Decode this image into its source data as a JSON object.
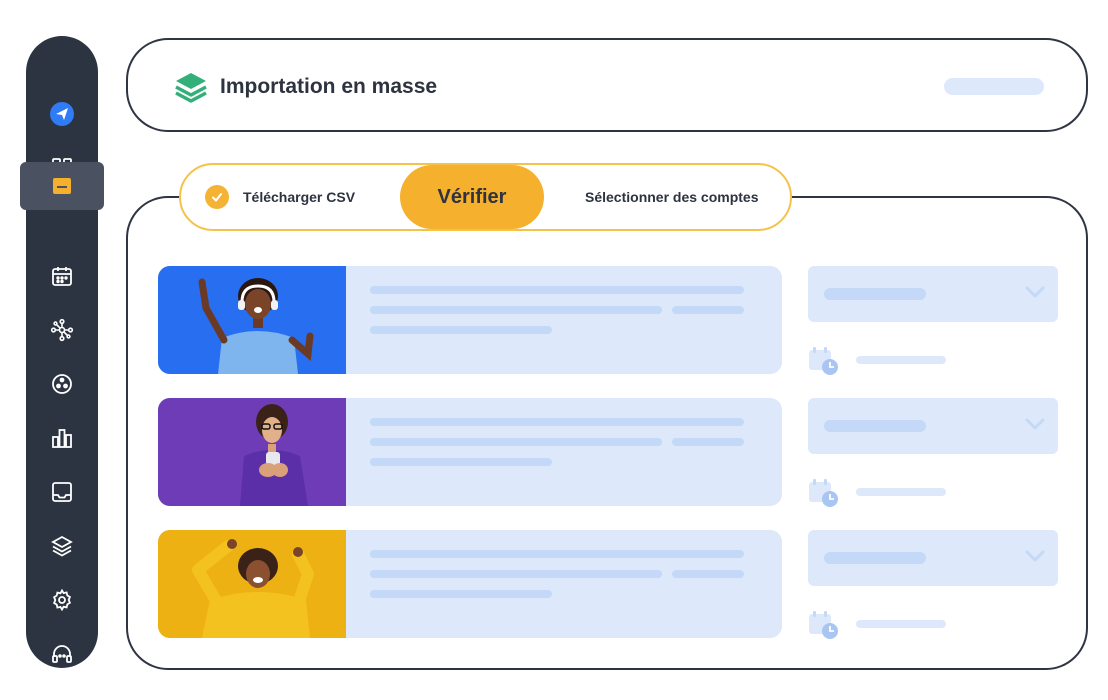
{
  "app": {
    "title": "Importation en masse",
    "accent": "#f5b02e",
    "sidebar_color": "#2c3341",
    "skeleton_color": "#dde9fb"
  },
  "sidebar": {
    "items": [
      {
        "icon": "paper-plane-logo-icon",
        "active": false
      },
      {
        "icon": "dashboard-grid-icon",
        "active": false
      },
      {
        "icon": "compose-post-icon",
        "active": true
      },
      {
        "icon": "calendar-icon",
        "active": false
      },
      {
        "icon": "network-hub-icon",
        "active": false
      },
      {
        "icon": "circle-dots-icon",
        "active": false
      },
      {
        "icon": "bar-chart-icon",
        "active": false
      },
      {
        "icon": "inbox-tray-icon",
        "active": false
      },
      {
        "icon": "layers-icon",
        "active": false
      },
      {
        "icon": "settings-gear-icon",
        "active": false
      },
      {
        "icon": "support-headset-icon",
        "active": false
      }
    ]
  },
  "stepper": {
    "step1": "Télécharger CSV",
    "step2": "Vérifier",
    "step3": "Sélectionner des comptes"
  },
  "rows": [
    {
      "photo": "woman-with-headphones-blue-background"
    },
    {
      "photo": "woman-with-glasses-and-phone-purple-background"
    },
    {
      "photo": "woman-cheering-yellow-background"
    }
  ]
}
